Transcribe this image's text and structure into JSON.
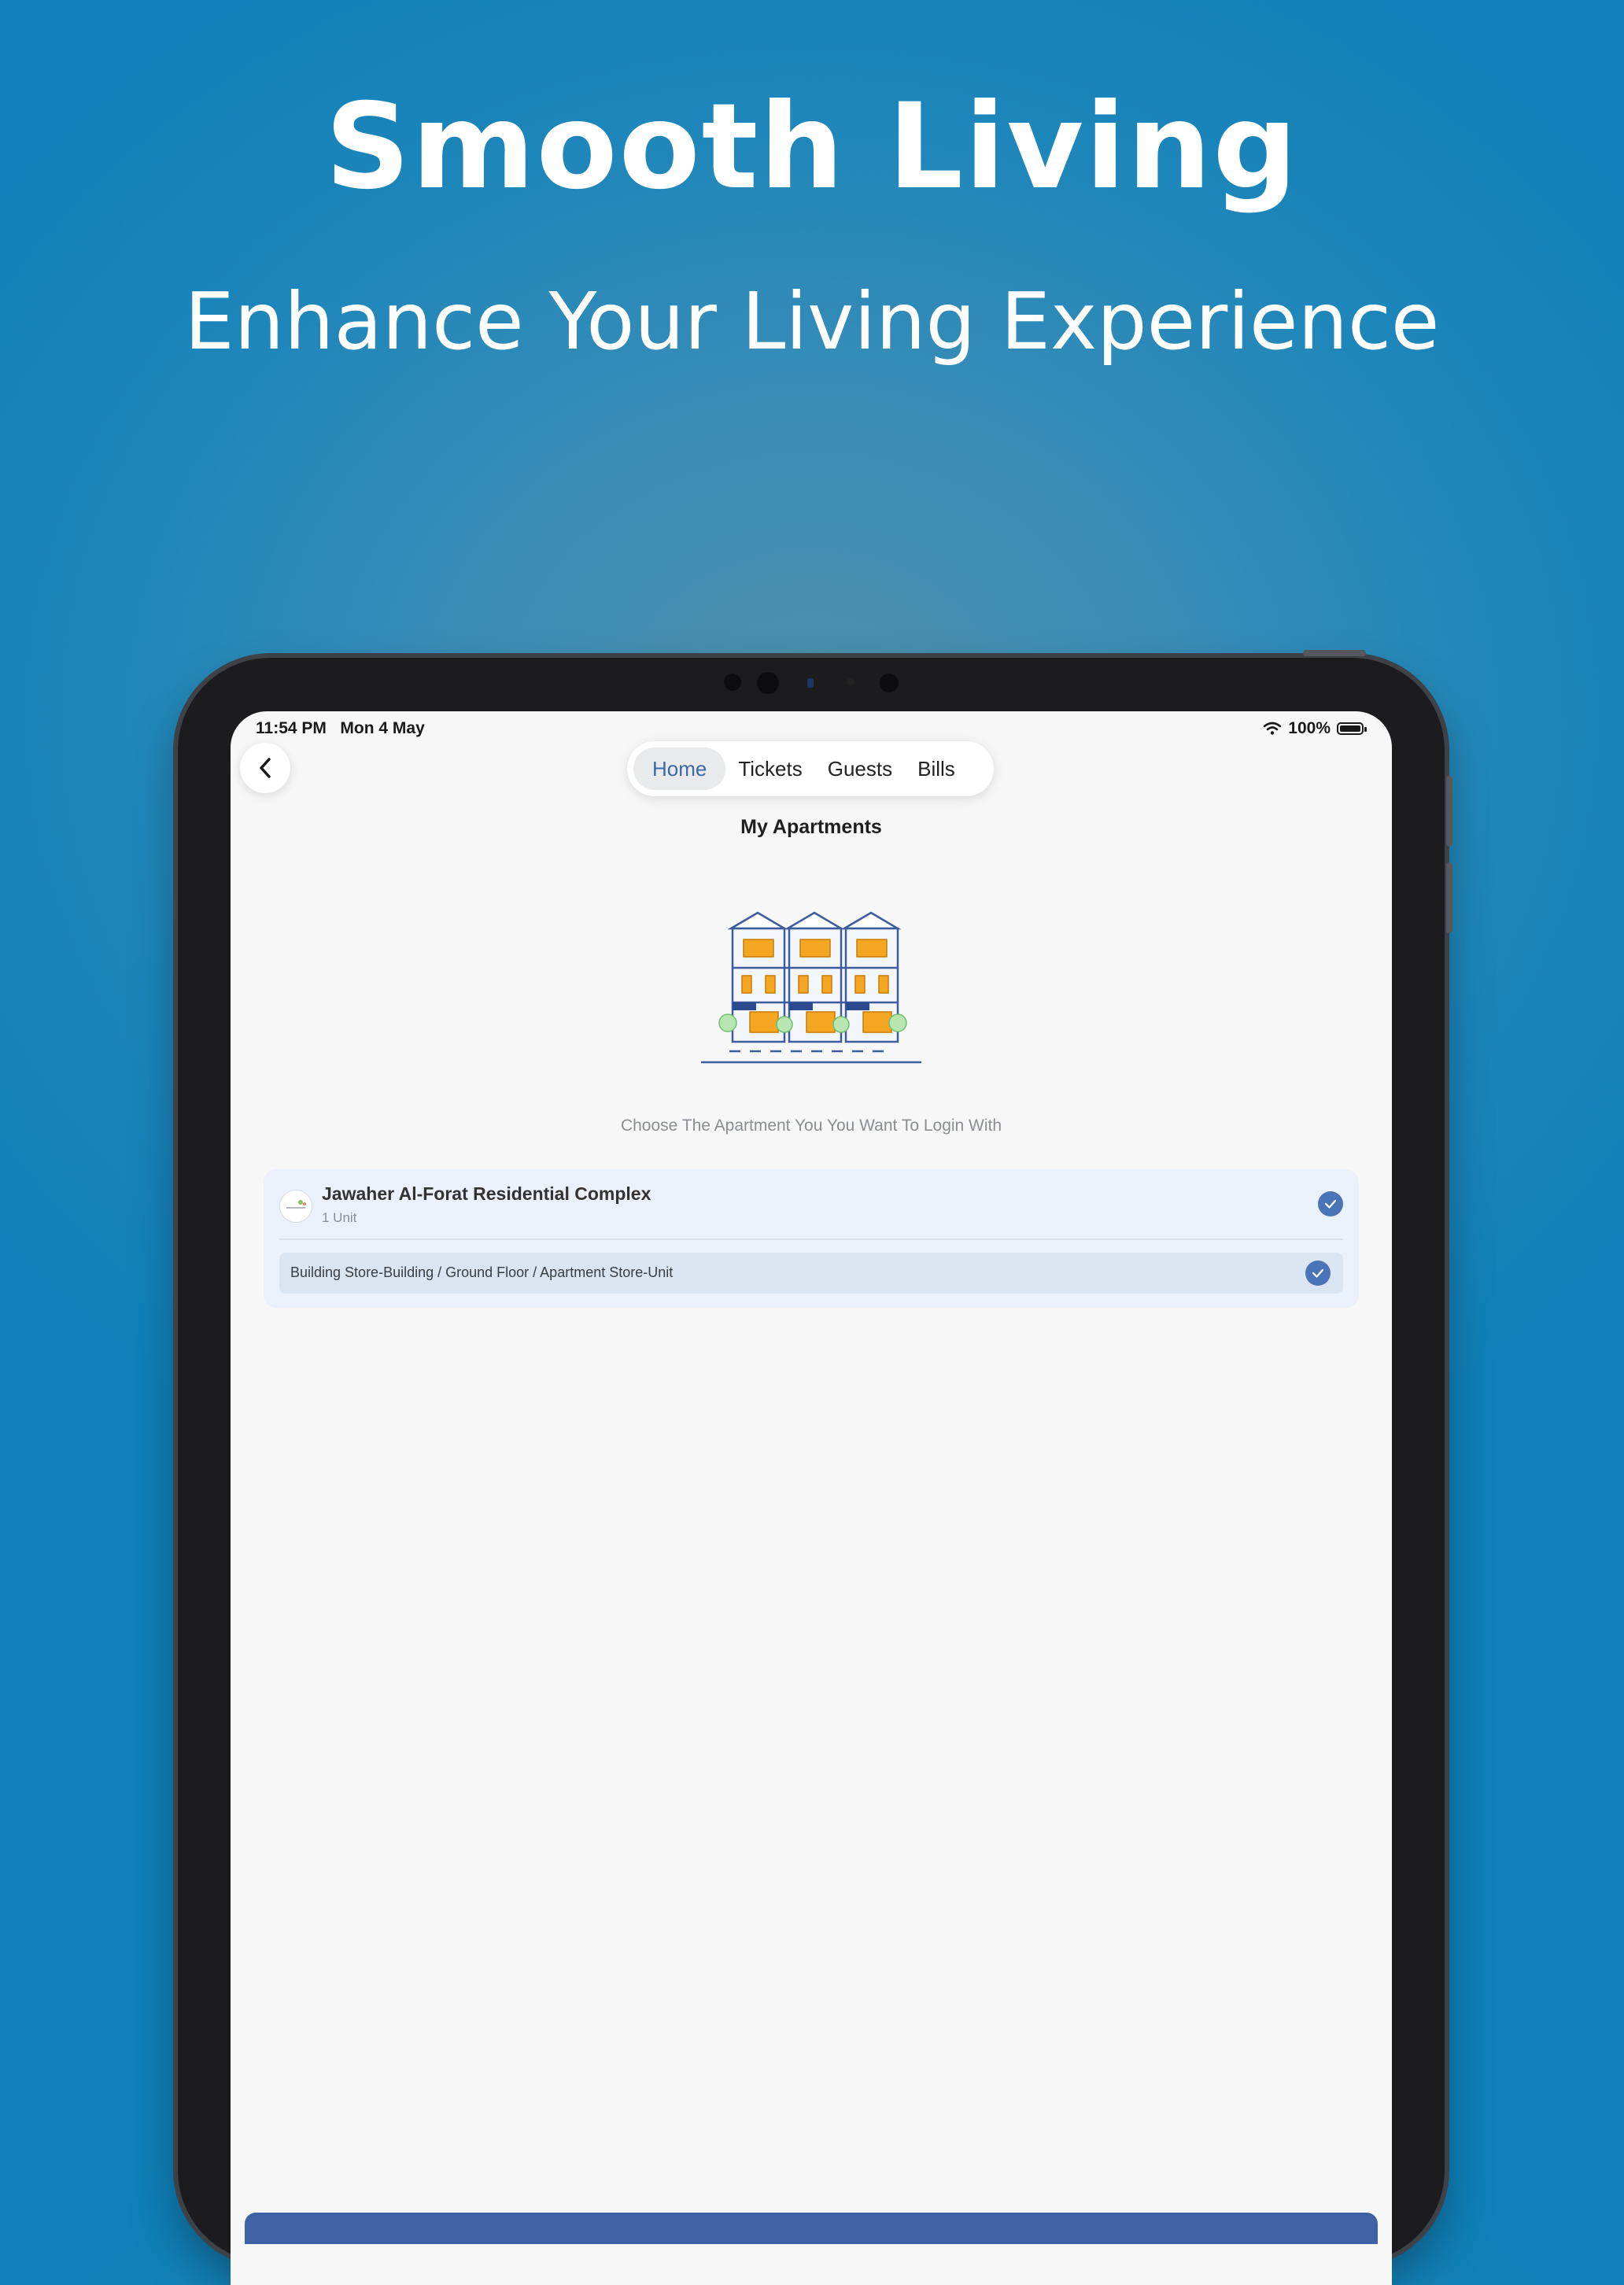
{
  "promo": {
    "headline": "Smooth Living",
    "subheadline": "Enhance Your Living Experience"
  },
  "status_bar": {
    "time": "11:54 PM",
    "date": "Mon 4 May",
    "battery": "100%"
  },
  "nav": {
    "tabs": [
      {
        "label": "Home",
        "active": true
      },
      {
        "label": "Tickets",
        "active": false
      },
      {
        "label": "Guests",
        "active": false
      },
      {
        "label": "Bills",
        "active": false
      }
    ]
  },
  "page": {
    "title": "My Apartments",
    "prompt": "Choose The Apartment You You Want To Login With"
  },
  "complex": {
    "name": "Jawaher Al-Forat Residential Complex",
    "units": "1 Unit",
    "selected": true,
    "unit_list": [
      {
        "label": "Building Store-Building / Ground Floor / Apartment Store-Unit",
        "selected": true
      }
    ]
  },
  "colors": {
    "background": "#1583bb",
    "accent": "#4a74b8",
    "card": "#eaf1fb"
  }
}
